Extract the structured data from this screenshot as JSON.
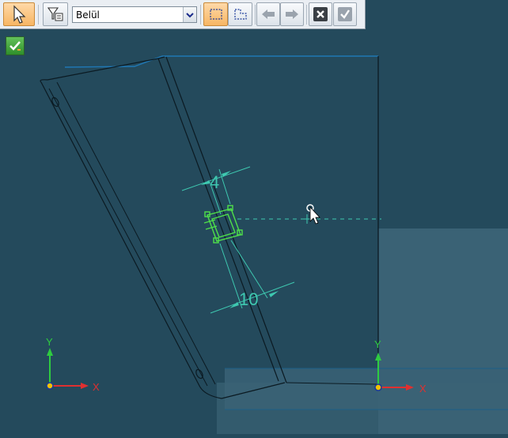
{
  "toolbar": {
    "select_tool_icon": "arrow-cursor-icon",
    "filter_icon": "filter-icon",
    "filter_value": "Belül",
    "rect_select_icon": "rectangle-select-icon",
    "poly_select_icon": "polygon-select-icon",
    "back_icon": "arrow-left-icon",
    "forward_icon": "arrow-right-icon",
    "cancel_icon": "close-icon",
    "accept_icon": "check-icon"
  },
  "canvas": {
    "dimension_width": "4",
    "dimension_length": "10",
    "axis_y_label": "Y",
    "axis_x_label": "X",
    "axis2_y_label": "Y",
    "axis2_x_label": "X",
    "quick_accept_icon": "check-icon"
  },
  "colors": {
    "background": "#244a5c",
    "edge": "#0b1a22",
    "dimension": "#3ec8b0",
    "selection": "#4fe04a",
    "axis_y": "#2ecc40",
    "axis_x": "#e03030",
    "pane": "#3a6275"
  }
}
